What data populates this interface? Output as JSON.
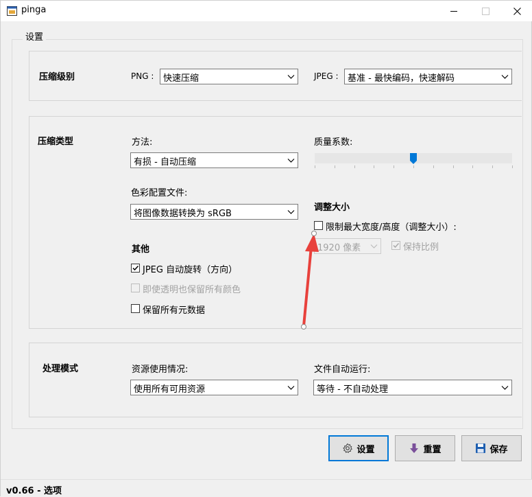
{
  "window": {
    "title": "pinga"
  },
  "settings_group": {
    "label": "设置"
  },
  "compression_level": {
    "title": "压缩级别",
    "png_label": "PNG :",
    "png_value": "快速压缩",
    "jpeg_label": "JPEG :",
    "jpeg_value": "基准 - 最快编码，快速解码"
  },
  "compression_type": {
    "title": "压缩类型",
    "method_label": "方法:",
    "method_value": "有损 - 自动压缩",
    "quality_label": "质量系数:",
    "quality_value": 0.5,
    "color_profile_label": "色彩配置文件:",
    "color_profile_value": "将图像数据转换为 sRGB",
    "resize_title": "调整大小",
    "limit_size_label": "限制最大宽度/高度（调整大小）:",
    "limit_size_checked": false,
    "size_value": "1920 像素",
    "keep_ratio_label": "保持比例",
    "keep_ratio_checked": true,
    "other_title": "其他",
    "jpeg_autorotate_label": "JPEG 自动旋转（方向）",
    "jpeg_autorotate_checked": true,
    "keep_colors_label": "即使透明也保留所有颜色",
    "keep_colors_checked": false,
    "keep_metadata_label": "保留所有元数据",
    "keep_metadata_checked": false
  },
  "processing_mode": {
    "title": "处理模式",
    "resource_label": "资源使用情况:",
    "resource_value": "使用所有可用资源",
    "autorun_label": "文件自动运行:",
    "autorun_value": "等待 - 不自动处理"
  },
  "buttons": {
    "settings": "设置",
    "reset": "重置",
    "save": "保存"
  },
  "status": {
    "text": "v0.66 - 选项"
  },
  "colors": {
    "accent": "#0078d7",
    "annotation": "#e8413c",
    "reset_icon": "#7a4f9a",
    "save_icon": "#1e5fb0"
  },
  "icons": [
    "app-icon",
    "minimize-icon",
    "maximize-icon",
    "close-icon",
    "chevron-down-icon",
    "gear-icon",
    "down-arrow-icon",
    "floppy-disk-icon"
  ]
}
